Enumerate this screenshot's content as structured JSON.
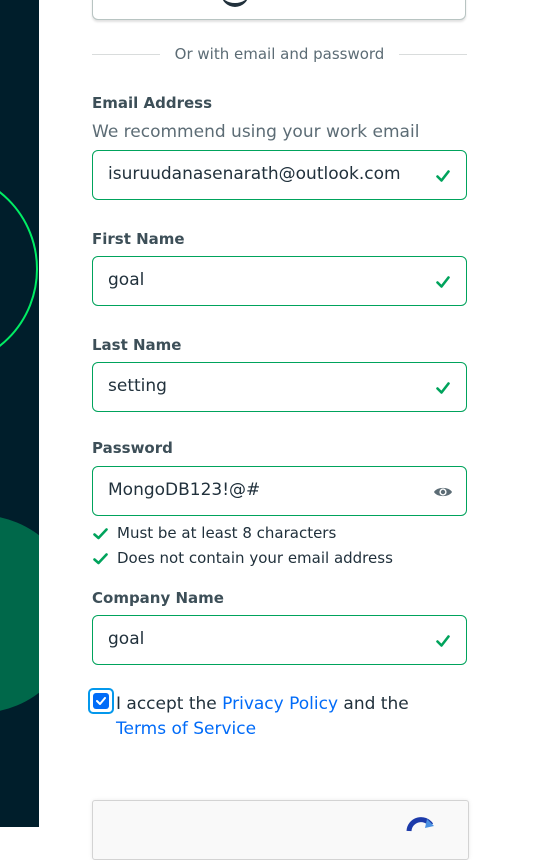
{
  "divider": {
    "text": "Or with email and password"
  },
  "email": {
    "label": "Email Address",
    "helper": "We recommend using your work email",
    "value": "isuruudanasenarath@outlook.com",
    "status_icon": "check-icon"
  },
  "first_name": {
    "label": "First Name",
    "value": "goal",
    "status_icon": "check-icon"
  },
  "last_name": {
    "label": "Last Name",
    "value": "setting",
    "status_icon": "check-icon"
  },
  "password": {
    "label": "Password",
    "value": "MongoDB123!@#",
    "toggle_icon": "eye-icon",
    "rules": [
      {
        "text": "Must be at least 8 characters",
        "met": true
      },
      {
        "text": "Does not contain your email address",
        "met": true
      }
    ]
  },
  "company_name": {
    "label": "Company Name",
    "value": "goal",
    "status_icon": "check-icon"
  },
  "terms": {
    "checked": true,
    "prefix": "I accept the",
    "privacy_link": "Privacy Policy",
    "middle": "and the",
    "tos_link": "Terms of Service"
  },
  "colors": {
    "valid_green": "#00a35c",
    "link_blue": "#016bf8",
    "side_panel": "#001e2b",
    "side_accent": "#00ed64"
  }
}
